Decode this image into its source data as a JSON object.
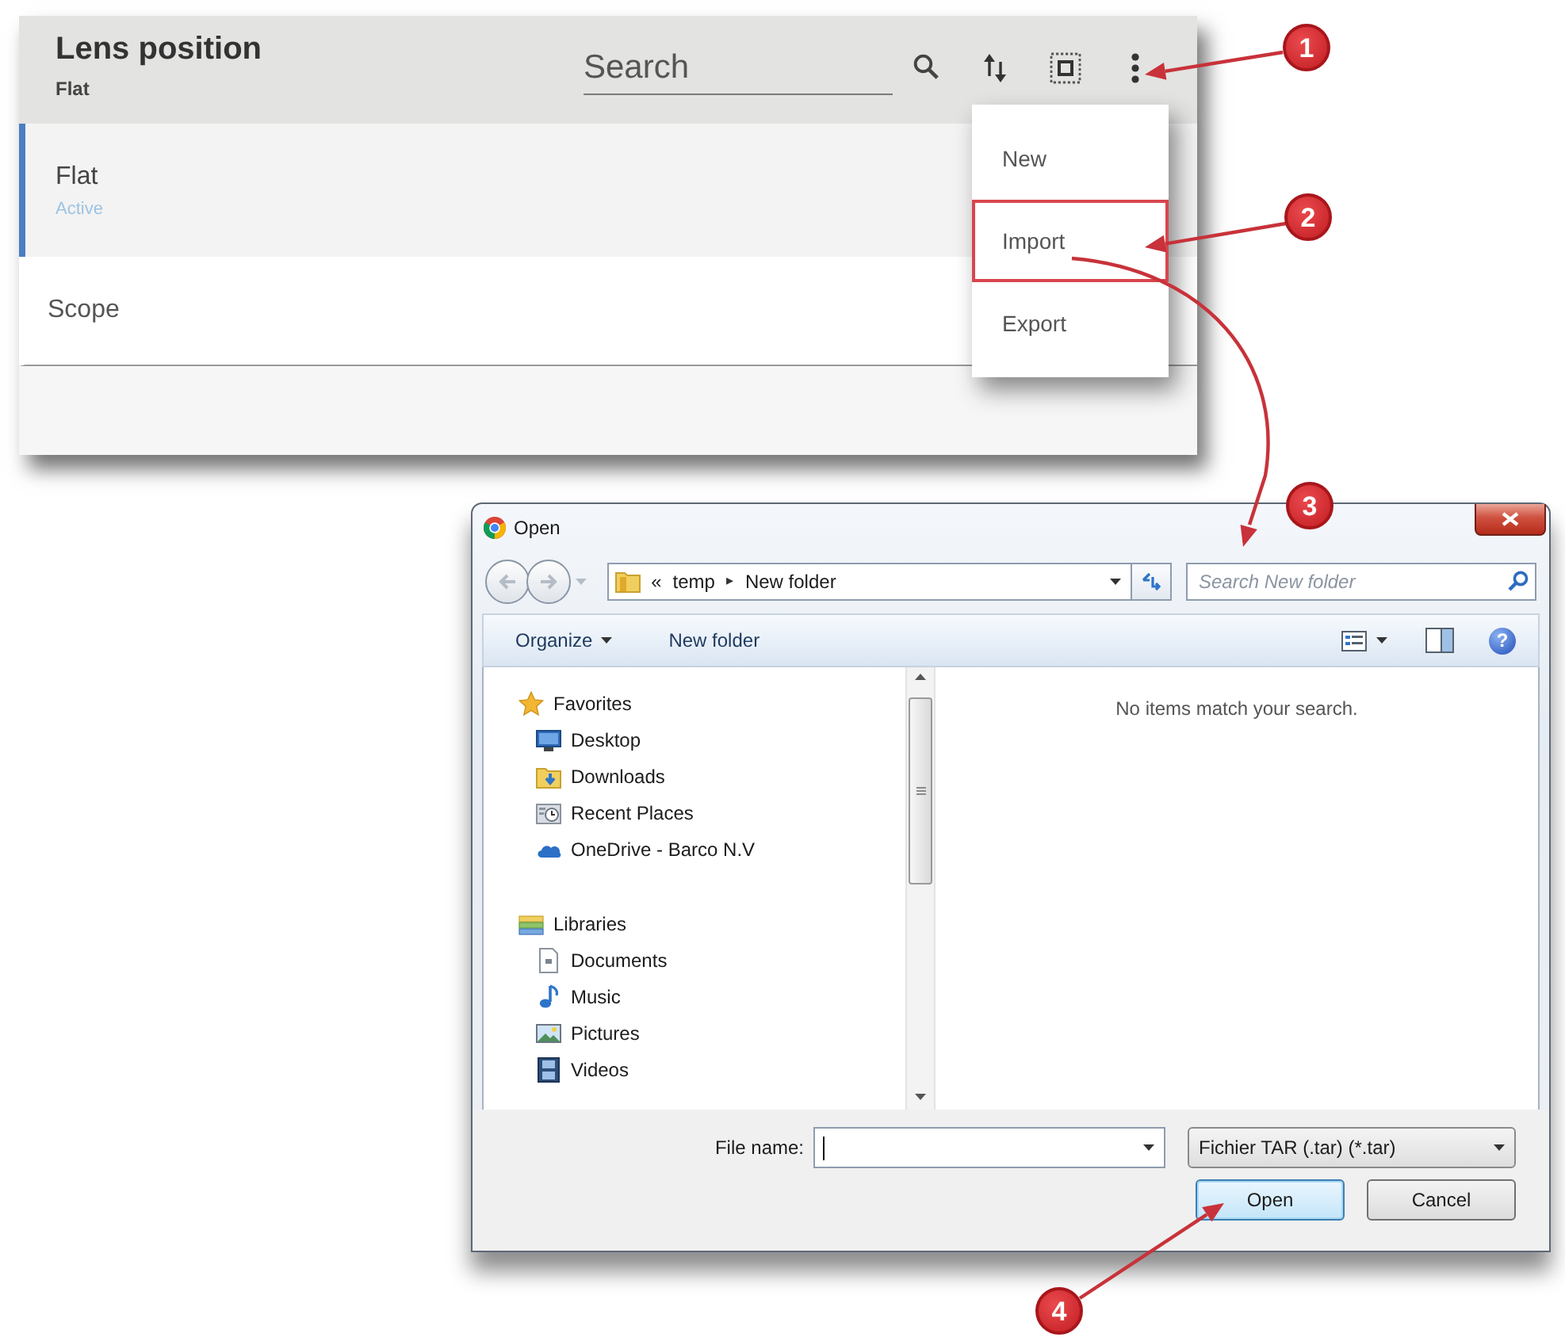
{
  "panel": {
    "title": "Lens position",
    "subtitle": "Flat",
    "search": {
      "placeholder": "Search"
    },
    "items": [
      {
        "label": "Flat",
        "status": "Active",
        "selected": true
      },
      {
        "label": "Scope",
        "selected": false
      }
    ]
  },
  "menu": {
    "items": [
      {
        "label": "New",
        "highlighted": false
      },
      {
        "label": "Import",
        "highlighted": true
      },
      {
        "label": "Export",
        "highlighted": false
      }
    ]
  },
  "dialog": {
    "title": "Open",
    "address": {
      "overflow_marker": "«",
      "crumbs": [
        {
          "label": "temp",
          "separator": "▸"
        },
        {
          "label": "New folder"
        }
      ]
    },
    "search": {
      "placeholder": "Search New folder"
    },
    "toolbar": [
      {
        "label": "Organize",
        "dropdown": true
      },
      {
        "label": "New folder",
        "dropdown": false
      }
    ],
    "help": "?",
    "nav": [
      {
        "label": "Favorites",
        "kind": "star",
        "children": [
          {
            "label": "Desktop",
            "kind": "desktop"
          },
          {
            "label": "Downloads",
            "kind": "downloads"
          },
          {
            "label": "Recent Places",
            "kind": "recent"
          },
          {
            "label": "OneDrive - Barco N.V",
            "kind": "cloud"
          }
        ]
      },
      {
        "label": "Libraries",
        "kind": "libraries",
        "children": [
          {
            "label": "Documents",
            "kind": "documents"
          },
          {
            "label": "Music",
            "kind": "music"
          },
          {
            "label": "Pictures",
            "kind": "pictures"
          },
          {
            "label": "Videos",
            "kind": "videos"
          }
        ]
      }
    ],
    "empty_message": "No items match your search.",
    "file_name": {
      "label": "File name:"
    },
    "file_type": {
      "value": "Fichier TAR (.tar) (*.tar)"
    },
    "buttons": [
      {
        "label": "Open",
        "default": true
      },
      {
        "label": "Cancel",
        "default": false
      }
    ]
  },
  "callouts": [
    {
      "number": "1"
    },
    {
      "number": "2"
    },
    {
      "number": "3"
    },
    {
      "number": "4"
    }
  ]
}
